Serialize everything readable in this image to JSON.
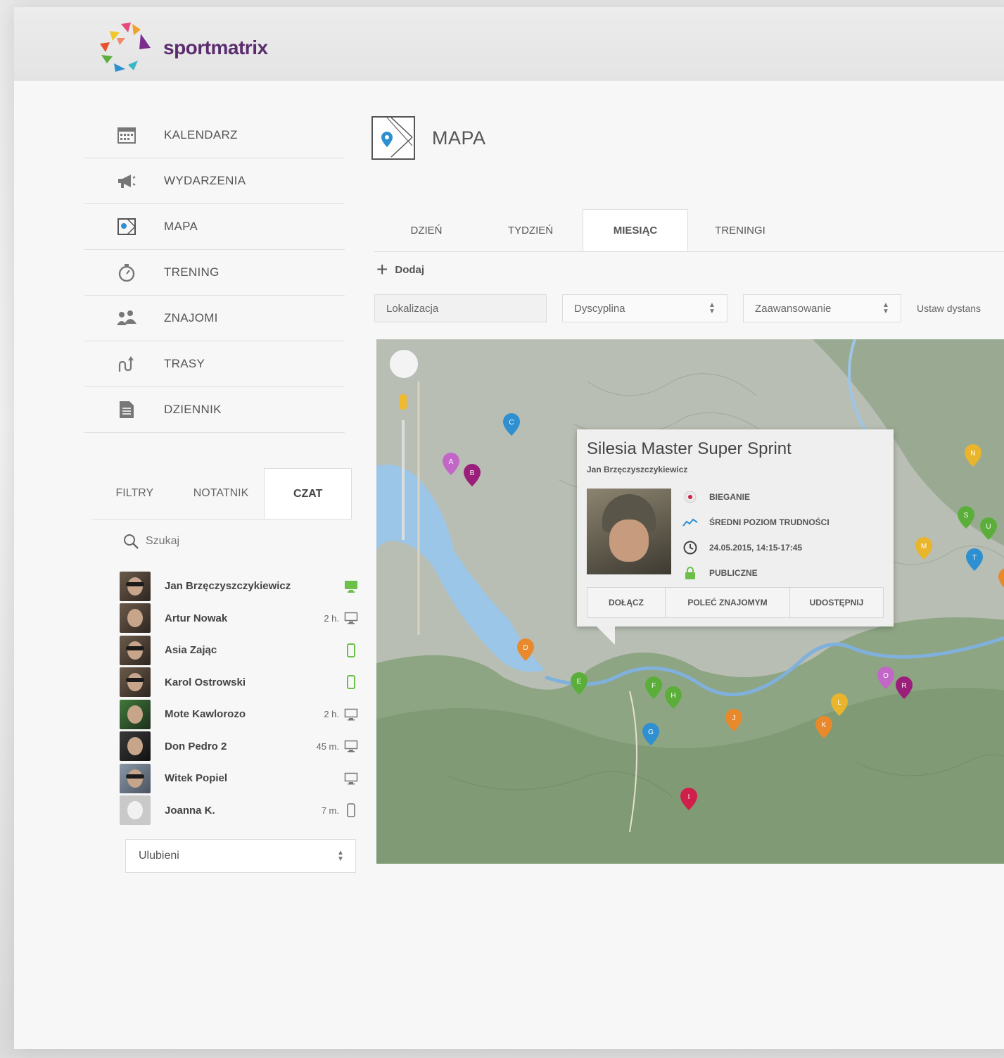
{
  "brand": {
    "name": "sportmatrix"
  },
  "nav": {
    "items": [
      {
        "label": "KALENDARZ",
        "icon": "calendar-icon"
      },
      {
        "label": "WYDARZENIA",
        "icon": "megaphone-icon"
      },
      {
        "label": "MAPA",
        "icon": "map-icon"
      },
      {
        "label": "TRENING",
        "icon": "stopwatch-icon"
      },
      {
        "label": "ZNAJOMI",
        "icon": "friends-icon"
      },
      {
        "label": "TRASY",
        "icon": "route-icon"
      },
      {
        "label": "DZIENNIK",
        "icon": "document-icon"
      }
    ]
  },
  "side_tabs": [
    {
      "label": "FILTRY"
    },
    {
      "label": "NOTATNIK"
    },
    {
      "label": "CZAT",
      "active": true
    }
  ],
  "search": {
    "placeholder": "Szukaj"
  },
  "chat": [
    {
      "name": "Jan Brzęczyszczykiewicz",
      "time": "",
      "device": "desktop",
      "online": true
    },
    {
      "name": "Artur Nowak",
      "time": "2 h.",
      "device": "desktop",
      "online": false
    },
    {
      "name": "Asia Zając",
      "time": "",
      "device": "mobile",
      "online": true
    },
    {
      "name": "Karol Ostrowski",
      "time": "",
      "device": "mobile",
      "online": true
    },
    {
      "name": "Mote Kawlorozo",
      "time": "2 h.",
      "device": "desktop",
      "online": false
    },
    {
      "name": "Don Pedro 2",
      "time": "45 m.",
      "device": "desktop",
      "online": false
    },
    {
      "name": "Witek Popiel",
      "time": "",
      "device": "desktop",
      "online": false
    },
    {
      "name": "Joanna K.",
      "time": "7 m.",
      "device": "mobile",
      "online": false
    }
  ],
  "favorites": {
    "selected": "Ulubieni"
  },
  "page": {
    "title": "MAPA"
  },
  "tabs": [
    {
      "label": "DZIEŃ"
    },
    {
      "label": "TYDZIEŃ"
    },
    {
      "label": "MIESIĄC",
      "active": true
    },
    {
      "label": "TRENINGI"
    }
  ],
  "add": {
    "label": "Dodaj"
  },
  "filters": {
    "location_placeholder": "Lokalizacja",
    "discipline": "Dyscyplina",
    "level": "Zaawansowanie",
    "distance": "Ustaw dystans"
  },
  "popup": {
    "title": "Silesia Master Super Sprint",
    "organizer": "Jan Brzęczyszczykiewicz",
    "discipline": "BIEGANIE",
    "difficulty": "ŚREDNI POZIOM TRUDNOŚCI",
    "datetime": "24.05.2015, 14:15-17:45",
    "visibility": "PUBLICZNE",
    "btn_join": "DOŁĄCZ",
    "btn_recommend": "POLEĆ ZNAJOMYM",
    "btn_share": "UDOSTĘPNIJ"
  },
  "pins": [
    {
      "letter": "C",
      "color": "#2e8fd1"
    },
    {
      "letter": "A",
      "color": "#c266c7"
    },
    {
      "letter": "B",
      "color": "#9b1f7a"
    },
    {
      "letter": "D",
      "color": "#e88a2c"
    },
    {
      "letter": "E",
      "color": "#5cae3a"
    },
    {
      "letter": "F",
      "color": "#5cae3a"
    },
    {
      "letter": "H",
      "color": "#5cae3a"
    },
    {
      "letter": "G",
      "color": "#2e8fd1"
    },
    {
      "letter": "J",
      "color": "#e88a2c"
    },
    {
      "letter": "I",
      "color": "#d01f4a"
    },
    {
      "letter": "K",
      "color": "#e88a2c"
    },
    {
      "letter": "L",
      "color": "#e8b52c"
    },
    {
      "letter": "O",
      "color": "#c266c7"
    },
    {
      "letter": "R",
      "color": "#9b1f7a"
    },
    {
      "letter": "M",
      "color": "#e8b52c"
    },
    {
      "letter": "N",
      "color": "#e8b52c"
    },
    {
      "letter": "S",
      "color": "#5cae3a"
    },
    {
      "letter": "U",
      "color": "#5cae3a"
    },
    {
      "letter": "T",
      "color": "#2e8fd1"
    },
    {
      "letter": "V",
      "color": "#e88a2c"
    }
  ],
  "colors": {
    "accent": "#5b2d6e",
    "online": "#6cc04a",
    "lake": "#9cc6e8",
    "terrain": "#8fa68a"
  }
}
